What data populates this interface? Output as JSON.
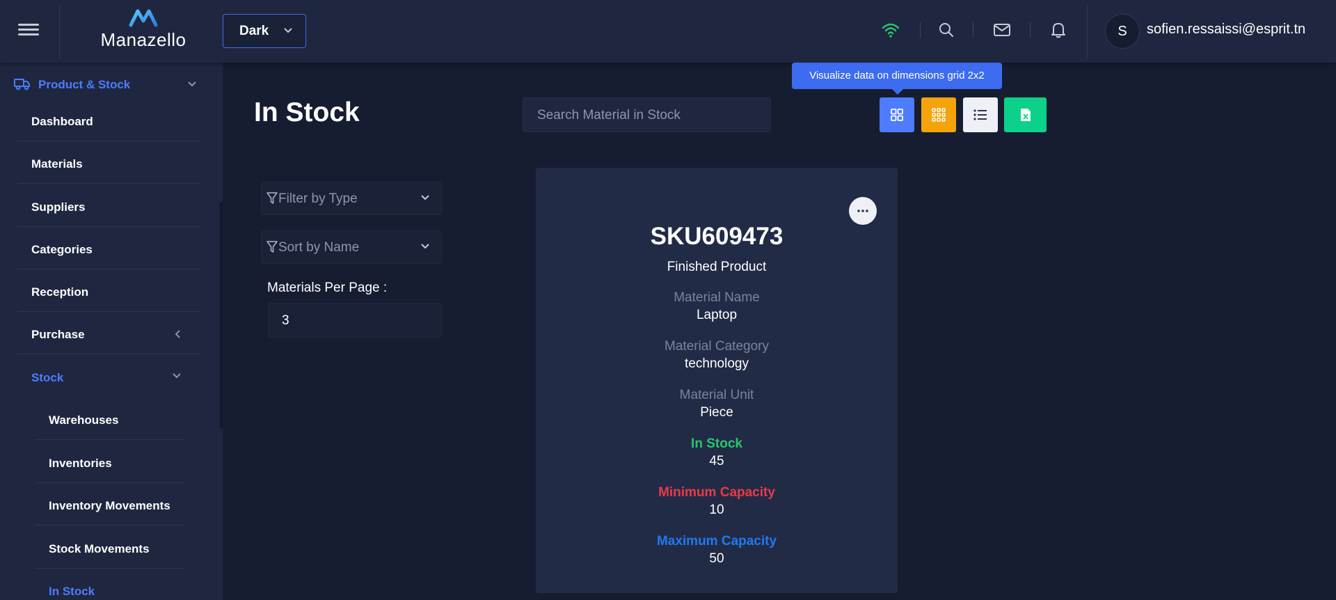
{
  "header": {
    "logo_text": "Manazello",
    "theme_value": "Dark",
    "user_initial": "S",
    "user_email": "sofien.ressaissi@esprit.tn"
  },
  "colors": {
    "accent": "#3d6cf0",
    "wifi": "#28c76f",
    "view_grid_2x2": "#4d7cff",
    "view_grid_3x3": "#f5a30a",
    "view_list": "#eef0f6",
    "view_excel": "#0bd18a"
  },
  "sidebar": {
    "parent": {
      "label": "Product & Stock",
      "icon": "truck-icon"
    },
    "items": [
      {
        "label": "Dashboard"
      },
      {
        "label": "Materials"
      },
      {
        "label": "Suppliers"
      },
      {
        "label": "Categories"
      },
      {
        "label": "Reception"
      },
      {
        "label": "Purchase"
      },
      {
        "label": "Stock"
      }
    ],
    "stock_sub": [
      {
        "label": "Warehouses"
      },
      {
        "label": "Inventories"
      },
      {
        "label": "Inventory Movements"
      },
      {
        "label": "Stock Movements"
      },
      {
        "label": "In Stock"
      }
    ]
  },
  "main": {
    "title": "In Stock",
    "search_placeholder": "Search Material in Stock",
    "tooltip": "Visualize data on dimensions grid 2x2",
    "view_buttons": [
      "grid-2x2-icon",
      "grid-3x3-icon",
      "list-icon",
      "excel-icon"
    ],
    "filter_type": "Filter by Type",
    "sort_name": "Sort by Name",
    "per_page_label": "Materials Per Page :",
    "per_page_value": "3"
  },
  "card": {
    "sku": "SKU609473",
    "type": "Finished Product",
    "name_label": "Material Name",
    "name_value": "Laptop",
    "category_label": "Material Category",
    "category_value": "technology",
    "unit_label": "Material Unit",
    "unit_value": "Piece",
    "instock_label": "In Stock",
    "instock_value": "45",
    "min_label": "Minimum Capacity",
    "min_value": "10",
    "max_label": "Maximum Capacity",
    "max_value": "50"
  }
}
